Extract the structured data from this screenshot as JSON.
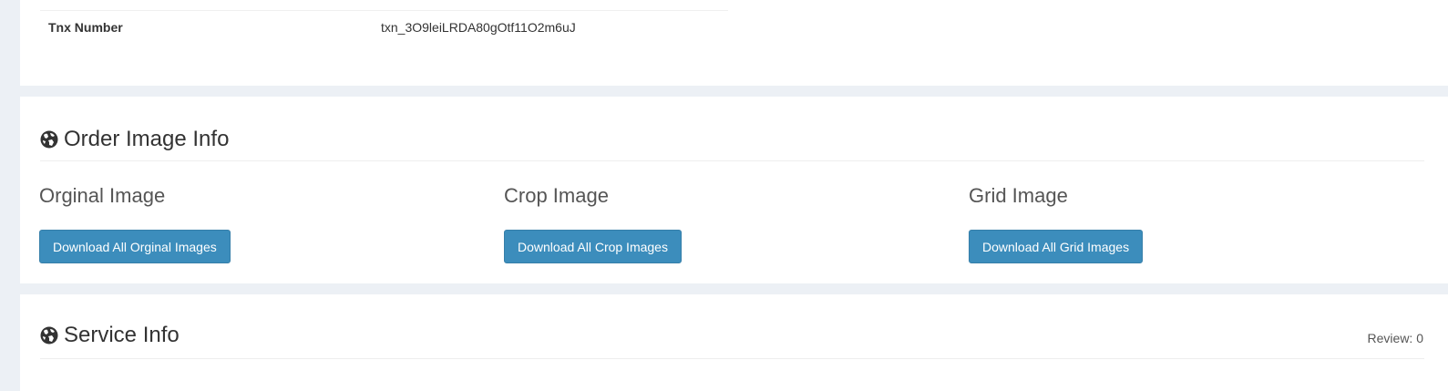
{
  "transaction": {
    "label": "Tnx Number",
    "value": "txn_3O9leiLRDA80gOtf11O2m6uJ"
  },
  "order_images": {
    "title": "Order Image Info",
    "icon": "globe-icon",
    "columns": [
      {
        "title": "Orginal Image",
        "button": "Download All Orginal Images"
      },
      {
        "title": "Crop Image",
        "button": "Download All Crop Images"
      },
      {
        "title": "Grid Image",
        "button": "Download All Grid Images"
      }
    ]
  },
  "service_info": {
    "title": "Service Info",
    "icon": "globe-icon",
    "review": "Review: 0"
  },
  "colors": {
    "page_bg": "#ecf0f5",
    "panel_bg": "#ffffff",
    "button_bg": "#3c8dbc",
    "button_border": "#367fa9"
  }
}
